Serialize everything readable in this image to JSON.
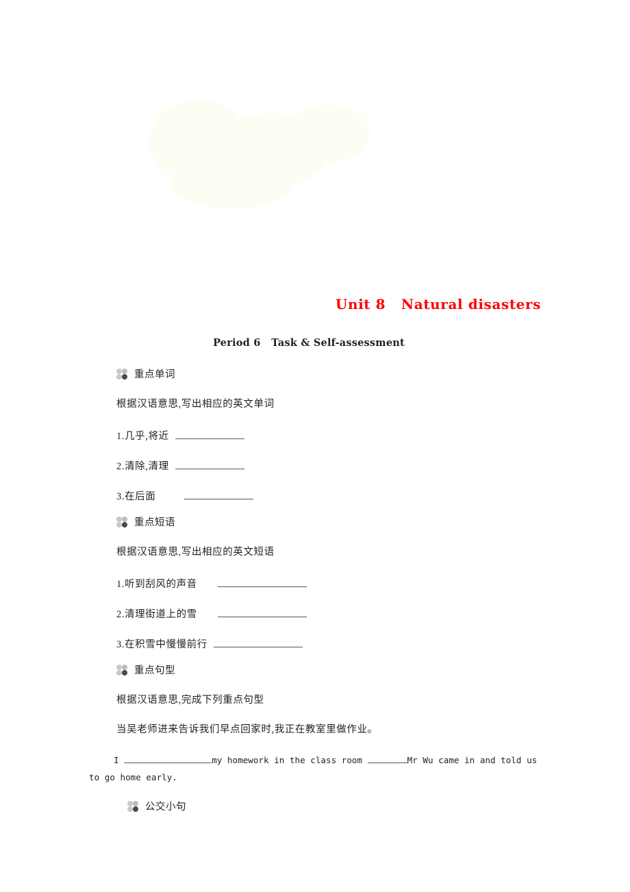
{
  "document": {
    "watermark_icon": "faint-decorative-watermark",
    "unit_title": "Unit 8   Natural disasters",
    "period_title": "Period 6   Task & Self-assessment"
  },
  "sections": [
    {
      "icon": "four-dot-clover-icon",
      "heading": "重点单词",
      "instruction": "根据汉语意思,写出相应的英文单词",
      "items": [
        {
          "number": "1.",
          "prompt": "几乎,将近"
        },
        {
          "number": "2.",
          "prompt": "清除,清理"
        },
        {
          "number": "3.",
          "prompt": "在后面"
        }
      ]
    },
    {
      "icon": "four-dot-clover-icon",
      "heading": "重点短语",
      "instruction": "根据汉语意思,写出相应的英文短语",
      "items": [
        {
          "number": "1.",
          "prompt": "听到刮风的声音"
        },
        {
          "number": "2.",
          "prompt": "清理街道上的雪"
        },
        {
          "number": "3.",
          "prompt": "在积雪中慢慢前行"
        }
      ]
    },
    {
      "icon": "four-dot-clover-icon",
      "heading": "重点句型",
      "instruction": "根据汉语意思,完成下列重点句型",
      "chinese_sentence": "当吴老师进来告诉我们早点回家时,我正在教室里做作业。",
      "english_sentence": {
        "part1": "I",
        "part2": "my homework in the class room",
        "part3": "Mr Wu came in and told",
        "part4": "us to go home early."
      }
    },
    {
      "icon": "four-dot-clover-icon",
      "heading": "公交小句"
    }
  ],
  "colors": {
    "title_red": "#ff0000",
    "body_text": "#231f20",
    "rule_gray": "#55565a",
    "icon_light": "#c9c9c9",
    "icon_dark": "#4a4a4a"
  }
}
